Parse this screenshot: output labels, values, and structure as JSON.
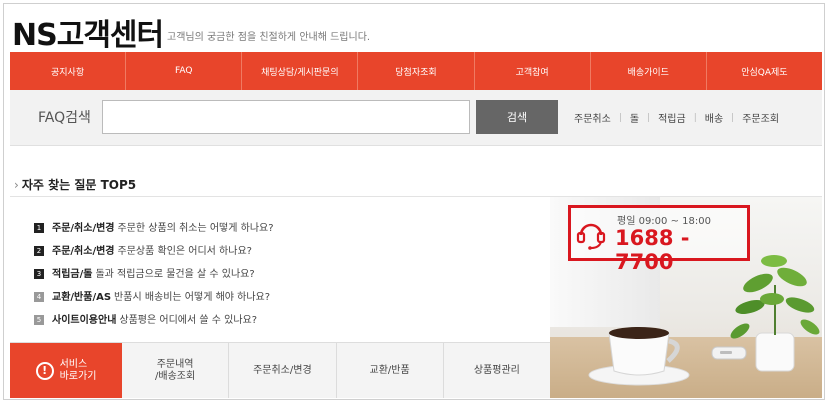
{
  "brand": {
    "title": "NS고객센터",
    "tagline": "고객님의 궁금한 점을 친절하게 안내해 드립니다."
  },
  "nav": [
    "공지사항",
    "FAQ",
    "채팅상담/게시판문의",
    "당첨자조회",
    "고객참여",
    "배송가이드",
    "안심QA제도"
  ],
  "faq_search": {
    "label": "FAQ검색",
    "input_value": "",
    "placeholder": "",
    "button_label": "검색",
    "quick_links": [
      "주문취소",
      "돌",
      "적립금",
      "배송",
      "주문조회"
    ]
  },
  "top5": {
    "title": "자주 찾는 질문 TOP5",
    "items": [
      {
        "num": "1",
        "category": "주문/취소/변경",
        "question": "주문한 상품의 취소는 어떻게 하나요?"
      },
      {
        "num": "2",
        "category": "주문/취소/변경",
        "question": "주문상품 확인은 어디서 하나요?"
      },
      {
        "num": "3",
        "category": "적립금/돌",
        "question": "돌과 적립금으로 물건을 살 수 있나요?"
      },
      {
        "num": "4",
        "category": "교환/반품/AS",
        "question": "반품시 배송비는 어떻게 해야 하나요?"
      },
      {
        "num": "5",
        "category": "사이트이용안내",
        "question": "상품평은 어디에서 쓸 수 있나요?"
      }
    ]
  },
  "service_bar": {
    "main_label_1": "서비스",
    "main_label_2": "바로가기",
    "main_icon": "!",
    "items": [
      {
        "line1": "주문내역",
        "line2": "/배송조회"
      },
      {
        "line1": "주문취소/변경",
        "line2": ""
      },
      {
        "line1": "교환/반품",
        "line2": ""
      },
      {
        "line1": "상품평관리",
        "line2": ""
      }
    ]
  },
  "call_center": {
    "hours": "평일 09:00 ~ 18:00",
    "phone": "1688 - 7700"
  },
  "colors": {
    "accent": "#e8452b",
    "phone_red": "#d9171f",
    "search_button": "#666666"
  }
}
